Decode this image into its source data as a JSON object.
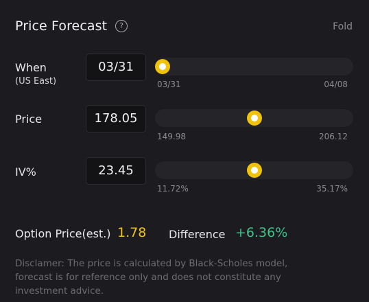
{
  "header": {
    "title": "Price Forecast",
    "help_icon": "?",
    "fold_label": "Fold"
  },
  "rows": [
    {
      "label": "When",
      "sublabel": "(US East)",
      "value": "03/31",
      "range_min": "03/31",
      "range_max": "04/08",
      "slider_fraction": 0.0
    },
    {
      "label": "Price",
      "value": "178.05",
      "range_min": "149.98",
      "range_max": "206.12",
      "slider_fraction": 0.5
    },
    {
      "label": "IV%",
      "value": "23.45",
      "range_min": "11.72%",
      "range_max": "35.17%",
      "slider_fraction": 0.5
    }
  ],
  "summary": {
    "option_price_label": "Option Price(est.)",
    "option_price_value": "1.78",
    "difference_label": "Difference",
    "difference_value": "+6.36%"
  },
  "disclaimer": "Disclamer: The price is calculated by Black-Scholes model, forecast is for reference only and does not constitute any investment advice.",
  "colors": {
    "accent": "#f0c20c",
    "positive": "#3ec38a",
    "background": "#1c1c20"
  }
}
